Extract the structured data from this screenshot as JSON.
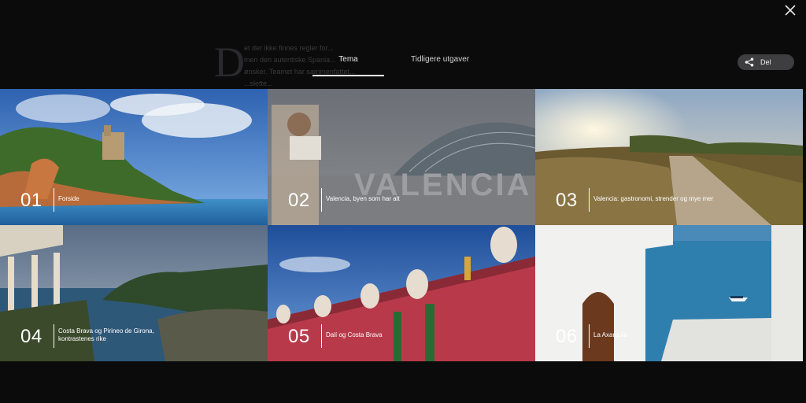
{
  "article": {
    "dropcap": "D",
    "lines": [
      "et der ikke finnes regler for...",
      "men den autentiske Spania...",
      "ønsker. Teamet har sammenfattet...",
      "...slette..."
    ]
  },
  "tabs": [
    {
      "label": "Tema",
      "active": true
    },
    {
      "label": "Tidligere utgaver",
      "active": false
    }
  ],
  "share": {
    "label": "Del",
    "icon": "share-icon"
  },
  "close": {
    "icon": "close-icon"
  },
  "tiles": [
    {
      "num": "01",
      "title": "Forside"
    },
    {
      "num": "02",
      "title": "Valencia, byen som har alt"
    },
    {
      "num": "03",
      "title": "Valencia: gastronomi, strender og mye mer"
    },
    {
      "num": "04",
      "title_line1": "Costa Brava og Pirineo de Girona,",
      "title_line2": "kontrastenes rike"
    },
    {
      "num": "05",
      "title": "Dalí og Costa Brava"
    },
    {
      "num": "06",
      "title": "La Axarquía"
    }
  ],
  "colors": {
    "background": "#0b0b0c",
    "share_bg": "#3e3e41",
    "text": "#ffffff"
  }
}
